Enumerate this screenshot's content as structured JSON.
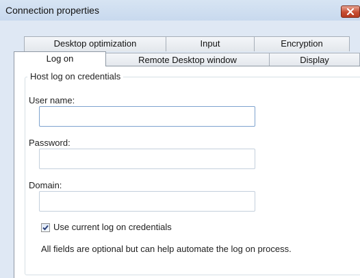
{
  "window": {
    "title": "Connection properties"
  },
  "tabs": {
    "row1": [
      "Desktop optimization",
      "Input",
      "Encryption"
    ],
    "row2": [
      "Log on",
      "Remote Desktop window",
      "Display"
    ],
    "active": "Log on"
  },
  "logon": {
    "group_title": "Host log on credentials",
    "username_label": "User name:",
    "username_value": "",
    "password_label": "Password:",
    "password_value": "",
    "domain_label": "Domain:",
    "domain_value": "",
    "use_current_checked": true,
    "use_current_label": "Use current log on credentials",
    "info": "All fields are optional but can help automate the log on process."
  },
  "icons": {
    "close": "close-icon",
    "check": "checkmark-icon"
  }
}
